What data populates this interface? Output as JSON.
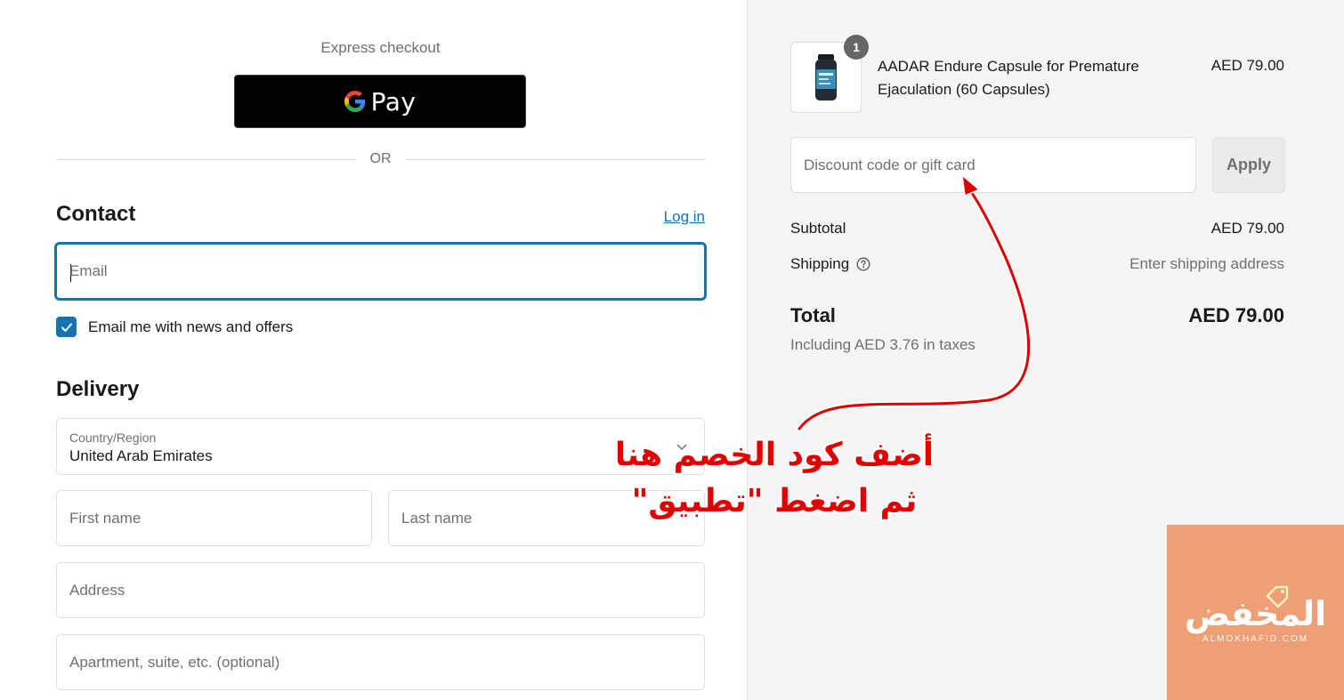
{
  "express": {
    "title": "Express checkout",
    "gpay_label": "Pay",
    "or_label": "OR"
  },
  "contact": {
    "heading": "Contact",
    "login_label": "Log in",
    "email_placeholder": "Email",
    "newsletter_label": "Email me with news and offers",
    "newsletter_checked": true
  },
  "delivery": {
    "heading": "Delivery",
    "country_label": "Country/Region",
    "country_value": "United Arab Emirates",
    "first_name_placeholder": "First name",
    "last_name_placeholder": "Last name",
    "address_placeholder": "Address",
    "apartment_placeholder": "Apartment, suite, etc. (optional)"
  },
  "summary": {
    "item": {
      "quantity": "1",
      "name": "AADAR Endure Capsule for Premature Ejaculation (60 Capsules)",
      "price": "AED 79.00"
    },
    "discount_placeholder": "Discount code or gift card",
    "apply_label": "Apply",
    "subtotal_label": "Subtotal",
    "subtotal_value": "AED 79.00",
    "shipping_label": "Shipping",
    "shipping_value": "Enter shipping address",
    "total_label": "Total",
    "total_value": "AED 79.00",
    "tax_note": "Including AED 3.76 in taxes"
  },
  "annotation": {
    "line1": "أضف كود الخصم هنا",
    "line2": "ثم اضغط \"تطبيق\"",
    "color": "#e00000"
  },
  "watermark": {
    "logo_text": "المخفض",
    "logo_sub": "ALMOKHAFID.COM",
    "color": "#ef9f75"
  },
  "colors": {
    "accent": "#1773b0",
    "summary_bg": "#f5f5f5"
  }
}
